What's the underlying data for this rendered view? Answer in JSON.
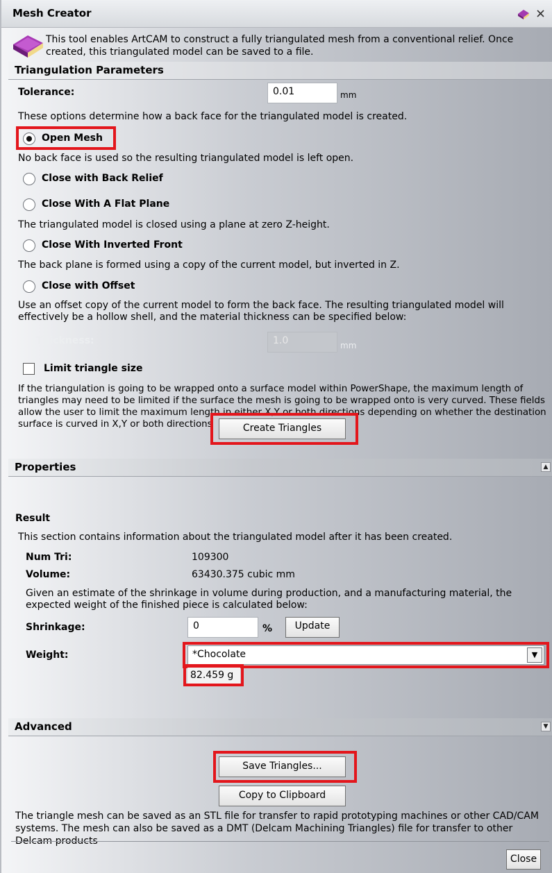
{
  "window": {
    "title": "Mesh Creator"
  },
  "intro": {
    "text": "This tool enables ArtCAM to construct a fully triangulated mesh from a conventional relief. Once created, this triangulated model can be saved to a file."
  },
  "triangulation": {
    "header": "Triangulation Parameters",
    "tolerance_label": "Tolerance:",
    "tolerance_value": "0.01",
    "tolerance_unit": "mm",
    "options_desc": "These options determine how a back face for the triangulated model is created.",
    "options": [
      {
        "label": "Open Mesh",
        "checked": true,
        "desc": "No back face is used so the resulting triangulated model is left open."
      },
      {
        "label": "Close with Back Relief",
        "checked": false,
        "desc": ""
      },
      {
        "label": "Close With A Flat Plane",
        "checked": false,
        "desc": "The triangulated model is closed using a plane at zero Z-height."
      },
      {
        "label": "Close With Inverted Front",
        "checked": false,
        "desc": "The back plane is formed using a copy of the current model, but inverted in Z."
      },
      {
        "label": "Close with Offset",
        "checked": false,
        "desc": "Use an offset copy of the current model to form the back face. The resulting triangulated model will effectively be a hollow shell, and the material thickness can be specified below:"
      }
    ],
    "thickness_label": "Thickness:",
    "thickness_value": "1.0",
    "thickness_unit": "mm",
    "limit_label": "Limit triangle size",
    "limit_checked": false,
    "limit_desc": "If the triangulation is going to be wrapped onto a surface model within PowerShape, the maximum length of triangles may need to be limited if the surface the mesh is going to be wrapped onto is very curved. These fields allow the user to limit the maximum length in either X,Y or both directions depending on whether the destination surface is curved in X,Y or both directions",
    "create_button": "Create Triangles"
  },
  "properties": {
    "header": "Properties",
    "header_arrow": "▲",
    "result_label": "Result",
    "result_desc": "This section contains information about the triangulated model after it has been created.",
    "num_tri_label": "Num Tri:",
    "num_tri_value": "109300",
    "volume_label": "Volume:",
    "volume_value": "63430.375 cubic mm",
    "estimate_desc": "Given an estimate of the shrinkage in volume during production, and a manufacturing material, the expected weight of the finished piece is calculated below:",
    "shrinkage_label": "Shrinkage:",
    "shrinkage_value": "0",
    "shrinkage_unit": "%",
    "update_button": "Update",
    "weight_label": "Weight:",
    "material_selected": "*Chocolate",
    "weight_value": "82.459 g"
  },
  "advanced": {
    "header": "Advanced",
    "header_arrow": "▼",
    "save_button": "Save Triangles...",
    "copy_button": "Copy to Clipboard",
    "save_desc": "The triangle mesh can be saved as an STL file for transfer to rapid prototyping machines or other CAD/CAM systems. The mesh can also be saved as a DMT (Delcam Machining Triangles) file for transfer to other Delcam products"
  },
  "footer": {
    "close_button": "Close"
  },
  "colors": {
    "highlight": "#e3161c",
    "book_icon": "#9b2fa6"
  }
}
